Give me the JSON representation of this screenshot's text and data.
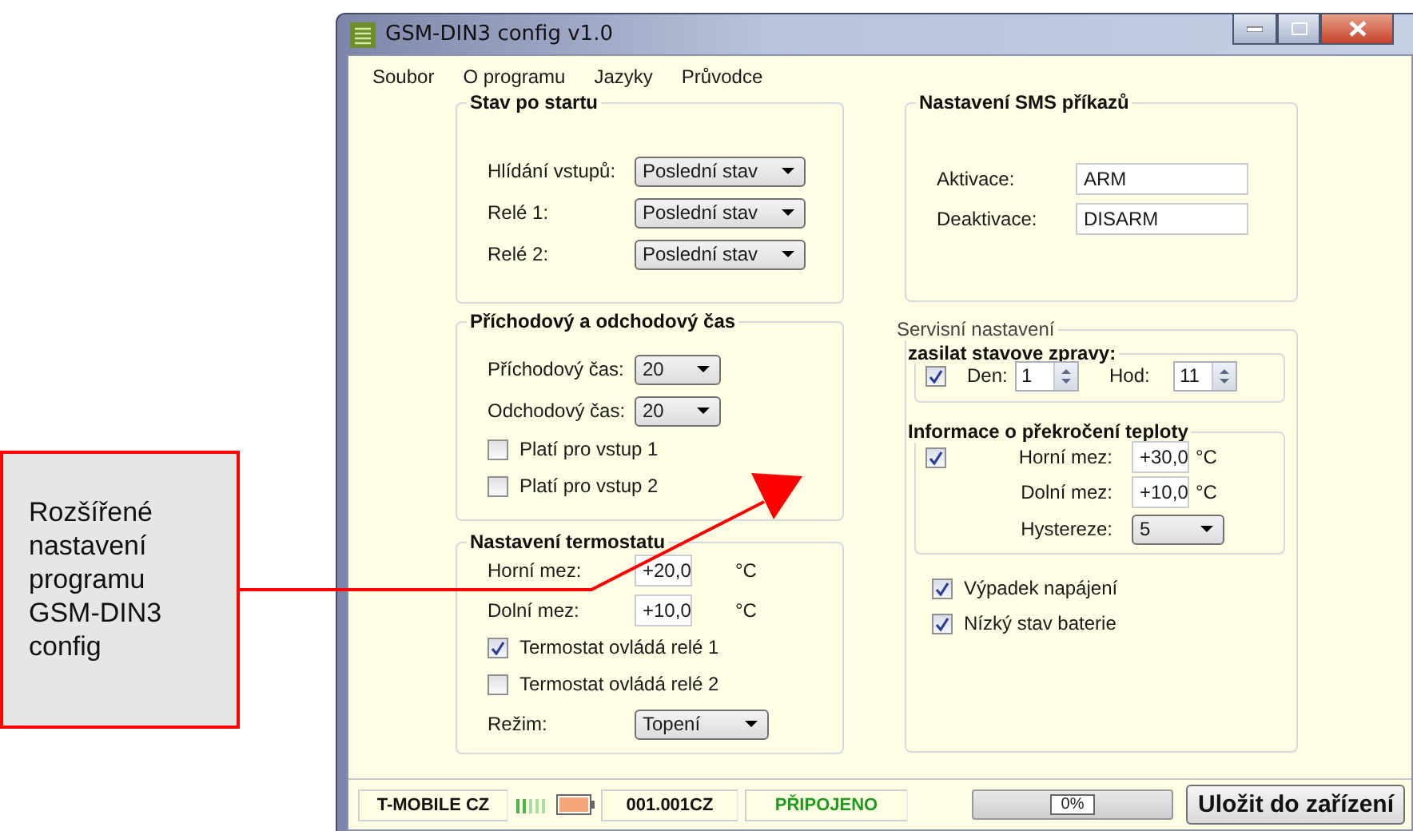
{
  "annotation": {
    "text": "Rozšířené nastavení programu GSM-DIN3 config"
  },
  "window": {
    "title": "GSM-DIN3 config v1.0"
  },
  "menu": [
    "Soubor",
    "O programu",
    "Jazyky",
    "Průvodce"
  ],
  "startup_group": {
    "title": "Stav po startu",
    "rows": [
      {
        "label": "Hlídání vstupů:",
        "value": "Poslední stav"
      },
      {
        "label": "Relé 1:",
        "value": "Poslední stav"
      },
      {
        "label": "Relé 2:",
        "value": "Poslední stav"
      }
    ]
  },
  "timing_group": {
    "title": "Příchodový a odchodový čas",
    "rows": [
      {
        "label": "Příchodový čas:",
        "value": "20"
      },
      {
        "label": "Odchodový čas:",
        "value": "20"
      }
    ],
    "checkboxes": [
      {
        "label": "Platí pro vstup 1",
        "checked": false
      },
      {
        "label": "Platí pro vstup 2",
        "checked": false
      }
    ]
  },
  "thermostat_group": {
    "title": "Nastavení termostatu",
    "fields": [
      {
        "label": "Horní mez:",
        "value": "+20,0",
        "unit": "°C"
      },
      {
        "label": "Dolní mez:",
        "value": "+10,0",
        "unit": "°C"
      }
    ],
    "checkboxes": [
      {
        "label": "Termostat ovládá relé 1",
        "checked": true
      },
      {
        "label": "Termostat ovládá relé 2",
        "checked": false
      }
    ],
    "mode": {
      "label": "Režim:",
      "value": "Topení"
    }
  },
  "sms_group": {
    "title": "Nastavení SMS příkazů",
    "fields": [
      {
        "label": "Aktivace:",
        "value": "ARM"
      },
      {
        "label": "Deaktivace:",
        "value": "DISARM"
      }
    ]
  },
  "service_group": {
    "title": "Servisní nastavení",
    "status_messages": {
      "title": "zasilat stavove zpravy:",
      "checked": true,
      "spinners": [
        {
          "label": "Den:",
          "value": "1"
        },
        {
          "label": "Hod:",
          "value": "11"
        }
      ]
    },
    "temperature_info": {
      "title": "Informace o překročení teploty",
      "checked": true,
      "fields": [
        {
          "label": "Horní mez:",
          "value": "+30,0",
          "unit": "°C"
        },
        {
          "label": "Dolní mez:",
          "value": "+10,0",
          "unit": "°C"
        }
      ],
      "hysteresis": {
        "label": "Hystereze:",
        "value": "5"
      }
    },
    "checkboxes": [
      {
        "label": "Výpadek napájení",
        "checked": true
      },
      {
        "label": "Nízký stav baterie",
        "checked": true
      }
    ]
  },
  "status_bar": {
    "operator": "T-MOBILE CZ",
    "number": "001.001CZ",
    "connection": "PŘIPOJENO",
    "progress": {
      "level": 0,
      "reading": "0%"
    },
    "save_button": "Uložit do zařízení"
  }
}
